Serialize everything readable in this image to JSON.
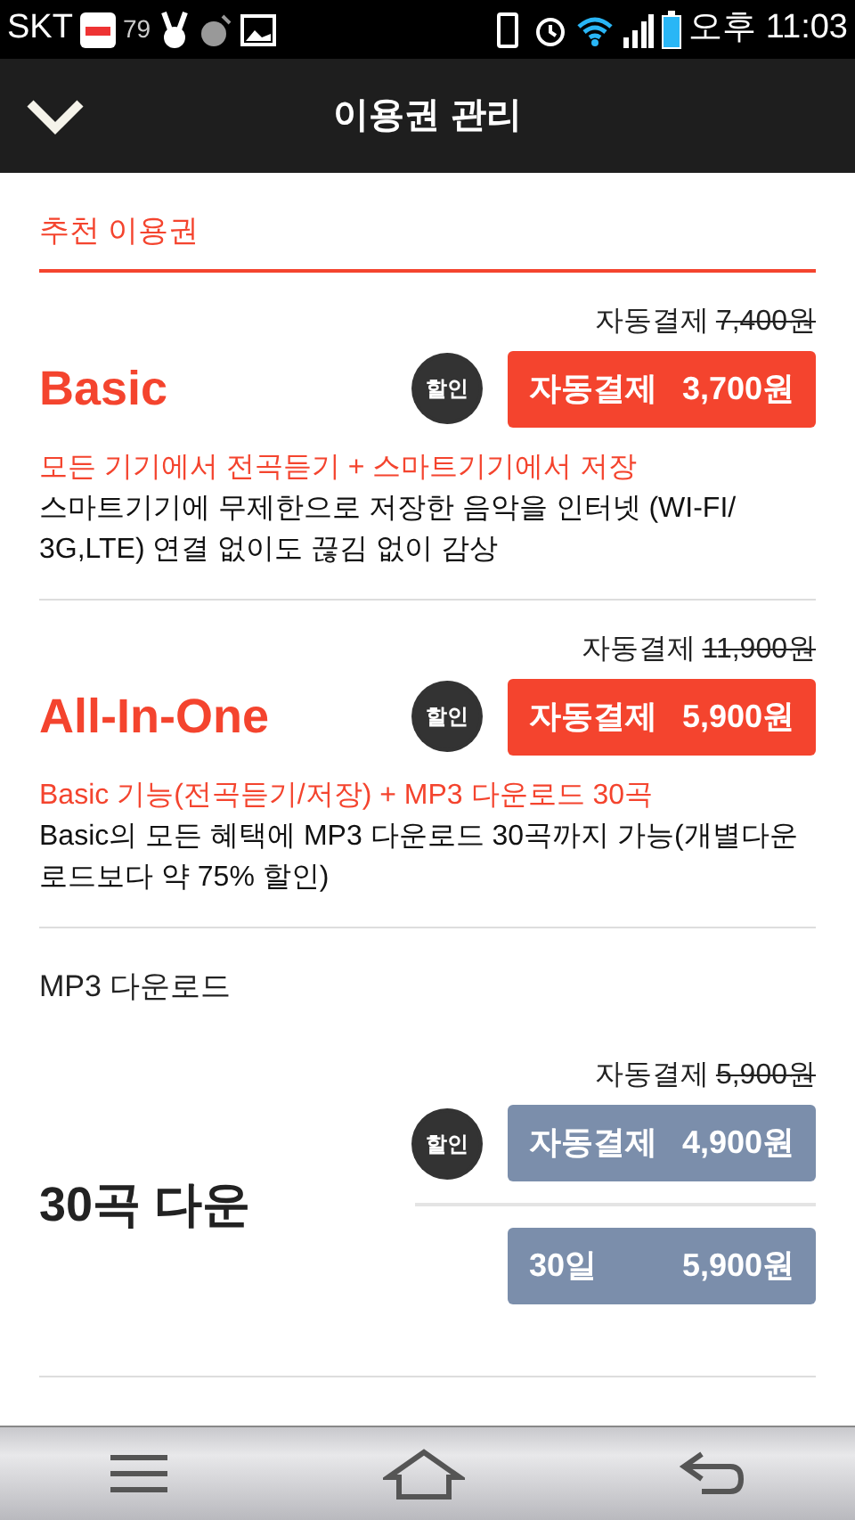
{
  "status_bar": {
    "carrier": "SKT",
    "count": "79",
    "time": "오후 11:03"
  },
  "header": {
    "title": "이용권 관리"
  },
  "sections": [
    {
      "title": "추천 이용권",
      "kind": "recommended",
      "products": [
        {
          "name": "Basic",
          "list_label": "자동결제",
          "list_price": "7,400원",
          "options": [
            {
              "label": "자동결제",
              "price": "3,700원",
              "badge": "할인"
            }
          ],
          "highlight": "모든 기기에서 전곡듣기 + 스마트기기에서 저장",
          "description": "스마트기기에 무제한으로 저장한 음악을 인터넷 (WI-FI/ 3G,LTE) 연결 없이도 끊김 없이 감상"
        },
        {
          "name": "All-In-One",
          "list_label": "자동결제",
          "list_price": "11,900원",
          "options": [
            {
              "label": "자동결제",
              "price": "5,900원",
              "badge": "할인"
            }
          ],
          "highlight": "Basic 기능(전곡듣기/저장) + MP3 다운로드 30곡",
          "description": "Basic의 모든 혜택에 MP3 다운로드 30곡까지 가능(개별다운로드보다 약 75% 할인)"
        }
      ]
    },
    {
      "title": "MP3 다운로드",
      "kind": "standard",
      "products": [
        {
          "name": "30곡 다운",
          "list_label": "자동결제",
          "list_price": "5,900원",
          "options": [
            {
              "label": "자동결제",
              "price": "4,900원",
              "badge": "할인"
            },
            {
              "label": "30일",
              "price": "5,900원"
            }
          ]
        }
      ]
    }
  ]
}
